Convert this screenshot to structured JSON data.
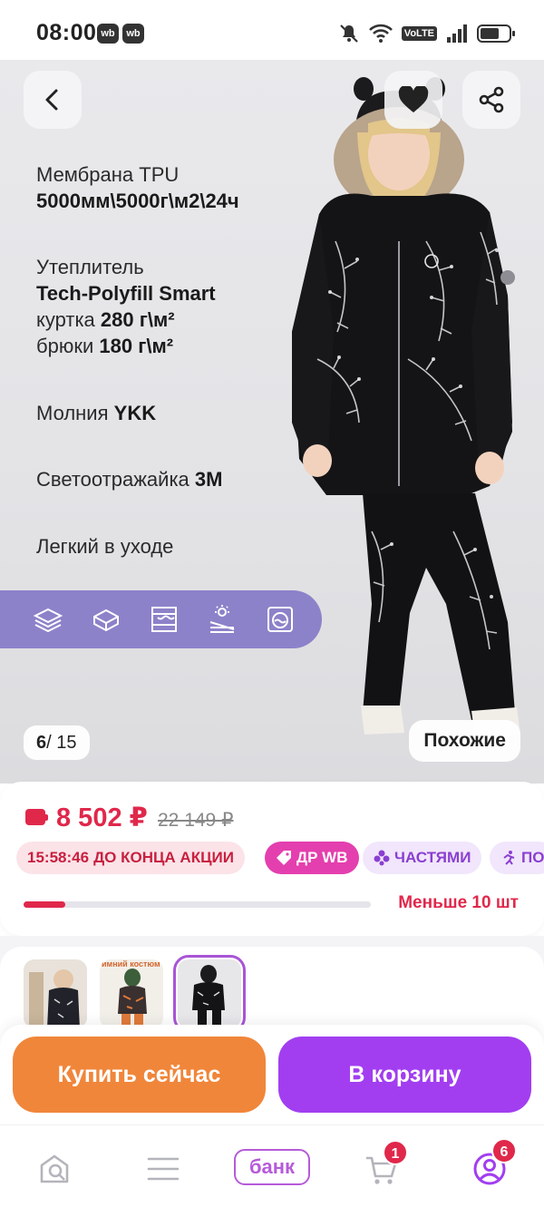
{
  "status_bar": {
    "time": "08:00",
    "app_badge_1": "wb",
    "app_badge_2": "wb",
    "network_label": "VoLTE",
    "battery_level": 0.7
  },
  "hero": {
    "specs": {
      "membrane_label": "Мембрана TPU",
      "membrane_value": "5000мм\\5000г\\м2\\24ч",
      "insulation_label": "Утеплитель",
      "insulation_value": "Tech-Polyfill Smart",
      "jacket_label": "куртка",
      "jacket_value": "280 г\\м²",
      "pants_label": "брюки",
      "pants_value": "180 г\\м²",
      "zipper_label": "Молния",
      "zipper_value": "YKK",
      "reflective_label": "Светоотражайка",
      "reflective_value": "3M",
      "care_label": "Легкий в уходе"
    },
    "feature_icons": [
      "layers-icon",
      "fabric-icon",
      "insulation-icon",
      "sun-water-icon",
      "washing-icon"
    ],
    "counter_current": "6",
    "counter_separator": "/",
    "counter_total": "15",
    "similar_label": "Похожие"
  },
  "price": {
    "current": "8 502 ₽",
    "old": "22 149 ₽",
    "chips": {
      "timer_time": "15:58:46",
      "timer_text": "ДО КОНЦА АКЦИИ",
      "dr_label": "ДР WB",
      "parts_label": "ЧАСТЯМИ",
      "more_label": "ПО"
    },
    "stock_progress": 0.12,
    "stock_text": "Меньше 10 шт"
  },
  "thumbnails": {
    "thumb2_caption": "имний костюм"
  },
  "actions": {
    "buy_now": "Купить сейчас",
    "add_to_cart": "В корзину"
  },
  "nav": {
    "bank_label": "банк",
    "cart_badge": "1",
    "profile_badge": "6"
  },
  "colors": {
    "accent_red": "#e0284b",
    "buy_orange": "#f0863a",
    "cart_purple": "#a23ef0",
    "feature_band": "#8c82c9",
    "promo_pink": "#e43fae"
  }
}
